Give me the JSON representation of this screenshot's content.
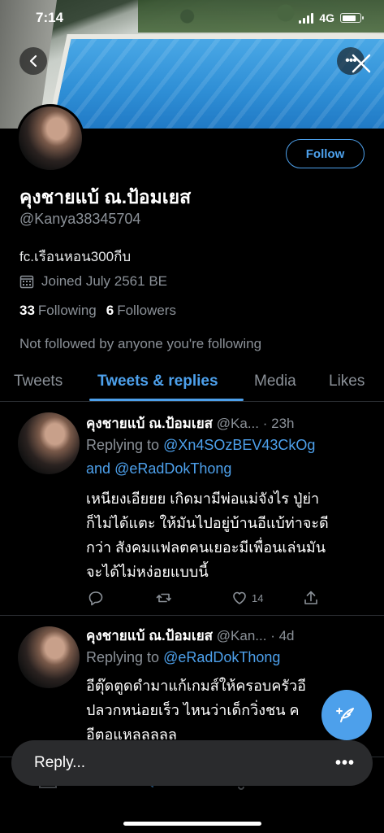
{
  "status_bar": {
    "time": "7:14",
    "network": "4G",
    "battery_level": 0.8
  },
  "profile": {
    "follow_label": "Follow",
    "name": "คุงชายแบ้ ณ.ป้อมเยส",
    "handle": "@Kanya38345704",
    "bio": "fc.เรือนหอน300กีบ",
    "joined": "Joined July 2561 BE",
    "following_count": "33",
    "following_label": "Following",
    "followers_count": "6",
    "followers_label": "Followers",
    "not_followed": "Not followed by anyone you're following"
  },
  "tabs": [
    "Tweets",
    "Tweets & replies",
    "Media",
    "Likes"
  ],
  "tweets": [
    {
      "name": "คุงชายแบ้ ณ.ป้อมเยส",
      "handle": "@Ka...",
      "time": "· 23h",
      "replying_to_label": "Replying to",
      "reply_mention_1": "@Xn4SOzBEV43CkOg",
      "reply_and": "and",
      "reply_mention_2": "@eRadDokThong",
      "text_lines": [
        "เหนียงเอียยย เกิดมามีพ่อแม่จังไร ปู่ย่า",
        "ก็ไม่ได้แตะ ให้มันไปอยู่บ้านอีแบ้ท่าจะดี",
        "กว่า สังคมแฟลตคนเยอะมีเพื่อนเล่นมัน",
        "จะได้ไม่หง่อยแบบนี้"
      ],
      "like_count": "14"
    },
    {
      "name": "คุงชายแบ้ ณ.ป้อมเยส",
      "handle": "@Kan...",
      "time": "· 4d",
      "replying_to_label": "Replying to",
      "reply_mention_1": "@eRadDokThong",
      "text_lines": [
        "อีตุ๊ดตูดดำมาแก้เกมส์ให้ครอบครัวอี",
        "ปลวกหน่อยเร็ว ไหนว่าเด็กวิ่งชน ค",
        "อีตอแหลลลลล"
      ]
    }
  ],
  "reply_bar": {
    "label": "Reply...",
    "menu": "•••"
  },
  "icons": [
    "back-icon",
    "more-icon",
    "close-icon",
    "calendar-icon",
    "reply-icon",
    "retweet-icon",
    "like-icon",
    "share-icon",
    "compose-icon",
    "home-icon",
    "search-icon",
    "bell-icon",
    "mail-icon"
  ],
  "colors": {
    "accent": "#4da0eb",
    "background": "#000000",
    "muted": "#8b9198"
  }
}
